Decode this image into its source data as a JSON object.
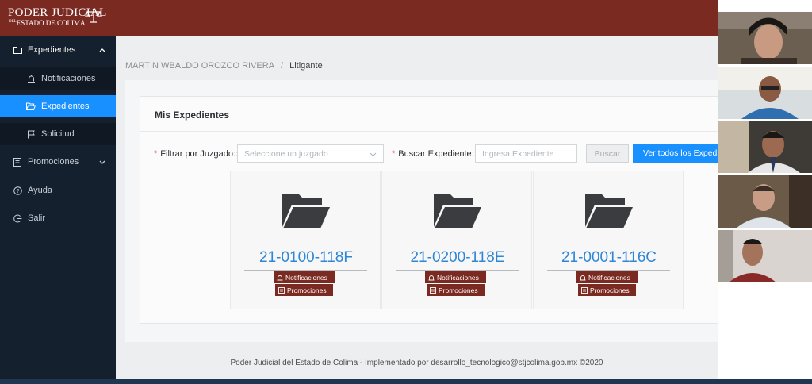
{
  "header": {
    "logo_line1": "PODER JUDICIAL",
    "logo_del": "DEL",
    "logo_line2": "ESTADO DE COLIMA",
    "scale_icon": "balance-scale-icon",
    "color": "#7b2a22"
  },
  "sidebar": {
    "items": [
      {
        "label": "Expedientes",
        "icon": "folder-icon",
        "expanded": true
      },
      {
        "label": "Notificaciones",
        "icon": "alarm-icon"
      },
      {
        "label": "Expedientes",
        "icon": "folder-open-icon",
        "active": true
      },
      {
        "label": "Solicitud",
        "icon": "flag-icon"
      },
      {
        "label": "Promociones",
        "icon": "document-icon",
        "expanded": false
      },
      {
        "label": "Ayuda",
        "icon": "question-circle-icon"
      },
      {
        "label": "Salir",
        "icon": "logout-icon"
      }
    ],
    "active_color": "#1990ff"
  },
  "breadcrumb": {
    "user": "MARTIN WBALDO OROZCO RIVERA",
    "separator": "/",
    "role": "Litigante"
  },
  "main": {
    "title": "Mis Expedientes",
    "filter": {
      "label": "Filtrar por Juzgado::",
      "placeholder": "Seleccione un juzgado"
    },
    "search": {
      "label": "Buscar Expediente::",
      "placeholder": "Ingresa Expediente",
      "button": "Buscar"
    },
    "view_all_button": "Ver todos los Expedientes",
    "expedientes": [
      {
        "code": "21-0100-118F",
        "notificaciones": "Notificaciones",
        "promociones": "Promociones"
      },
      {
        "code": "21-0200-118E",
        "notificaciones": "Notificaciones",
        "promociones": "Promociones"
      },
      {
        "code": "21-0001-116C",
        "notificaciones": "Notificaciones",
        "promociones": "Promociones"
      }
    ]
  },
  "footer": {
    "text": "Poder Judicial del Estado de Colima - Implementado por desarrollo_tecnologico@stjcolima.gob.mx ©2020"
  },
  "video_participants": [
    {
      "name": "participant-1"
    },
    {
      "name": "participant-2"
    },
    {
      "name": "participant-3"
    },
    {
      "name": "participant-4"
    },
    {
      "name": "participant-5"
    }
  ]
}
